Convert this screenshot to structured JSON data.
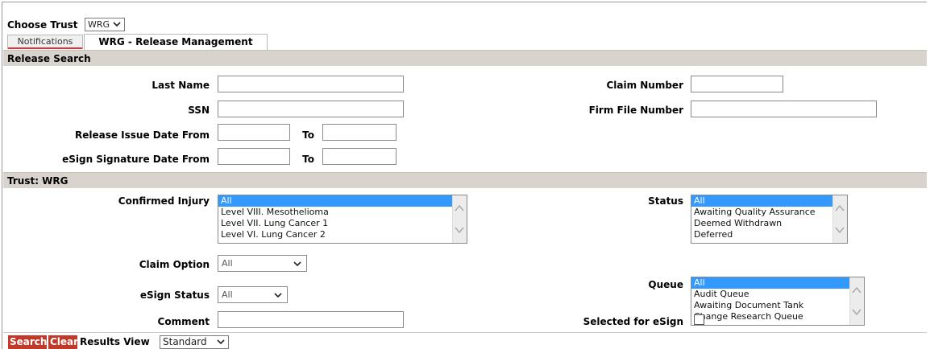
{
  "header": {
    "choose_trust_label": "Choose Trust",
    "trust_value": "WRG"
  },
  "tabs": [
    {
      "label": "Notifications",
      "active": false
    },
    {
      "label": "WRG - Release Management",
      "active": true
    }
  ],
  "release_search": {
    "section_title": "Release Search",
    "last_name_label": "Last Name",
    "last_name_value": "",
    "ssn_label": "SSN",
    "ssn_value": "",
    "release_issue_date_from_label": "Release Issue Date From",
    "to_label": "To",
    "esign_signature_date_from_label": "eSign Signature Date From",
    "to_label_2": "To",
    "claim_number_label": "Claim Number",
    "claim_number_value": "",
    "firm_file_number_label": "Firm File Number",
    "firm_file_number_value": ""
  },
  "trust_section": {
    "section_title": "Trust: WRG",
    "confirmed_injury_label": "Confirmed Injury",
    "confirmed_injury_options": [
      "All",
      "Level VIII. Mesothelioma",
      "Level VII. Lung Cancer 1",
      "Level VI. Lung Cancer 2"
    ],
    "claim_option_label": "Claim Option",
    "claim_option_value": "All",
    "esign_status_label": "eSign Status",
    "esign_status_value": "All",
    "comment_label": "Comment",
    "comment_value": "",
    "status_label": "Status",
    "status_options": [
      "All",
      "Awaiting Quality Assurance",
      "Deemed Withdrawn",
      "Deferred"
    ],
    "queue_label": "Queue",
    "queue_options": [
      "All",
      "Audit Queue",
      "Awaiting Document Tank",
      "Change Research Queue"
    ],
    "selected_for_esign_label": "Selected for eSign",
    "selected_for_esign_checked": false
  },
  "footer": {
    "search_button": "Search",
    "clear_button": "Clear",
    "results_view_label": "Results View",
    "results_view_value": "Standard"
  },
  "colors": {
    "section_bar": "#d8d4cd",
    "selected_option": "#3399ff",
    "action_button": "#c0392b"
  }
}
